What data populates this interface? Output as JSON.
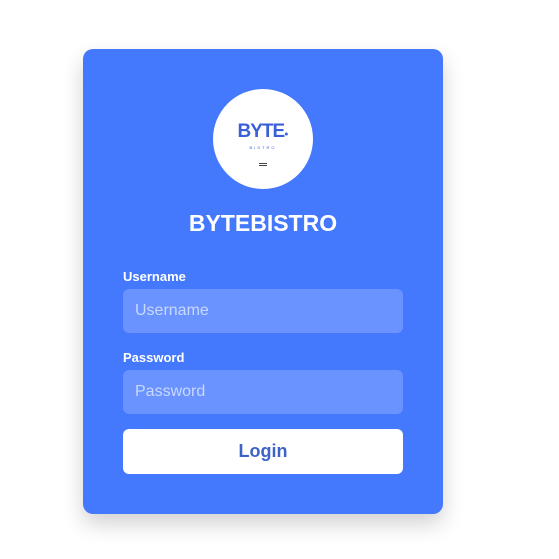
{
  "brand": {
    "logo_text": "BYTE",
    "logo_subtext": "BISTRO",
    "title": "BYTEBISTRO"
  },
  "form": {
    "username_label": "Username",
    "username_placeholder": "Username",
    "username_value": "",
    "password_label": "Password",
    "password_placeholder": "Password",
    "password_value": "",
    "login_label": "Login"
  },
  "colors": {
    "page_background": "#ffffff",
    "card_background": "#4479fe",
    "input_background": "#6a93ff",
    "button_background": "#ffffff",
    "button_text": "#3e63c7",
    "logo_text": "#3b5fd9"
  }
}
